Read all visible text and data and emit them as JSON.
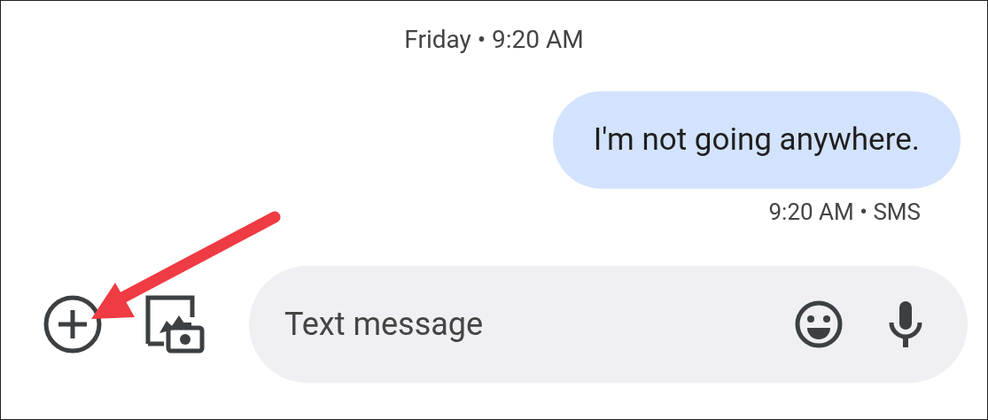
{
  "timestamp": "Friday • 9:20 AM",
  "messages": [
    {
      "text": "I'm not going anywhere.",
      "meta": "9:20 AM • SMS",
      "outgoing": true
    }
  ],
  "composer": {
    "placeholder": "Text message"
  }
}
